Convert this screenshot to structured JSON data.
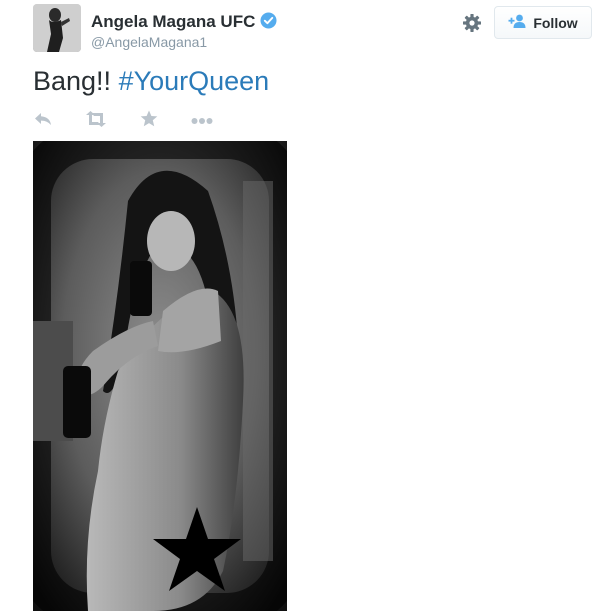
{
  "user": {
    "display_name": "Angela Magana UFC",
    "handle": "@AngelaMagana1",
    "verified": true
  },
  "follow_button": {
    "label": "Follow"
  },
  "tweet": {
    "text": "Bang!! ",
    "hashtag": "#YourQueen"
  },
  "icons": [
    "verified-badge-icon",
    "gear-icon",
    "follow-person-icon",
    "reply-icon",
    "retweet-icon",
    "favorite-icon",
    "more-icon"
  ],
  "colors": {
    "link": "#2b7bb9",
    "verified": "#55acee",
    "icon_gray": "#bbc4cc",
    "text": "#292f33",
    "muted": "#8899a6"
  }
}
